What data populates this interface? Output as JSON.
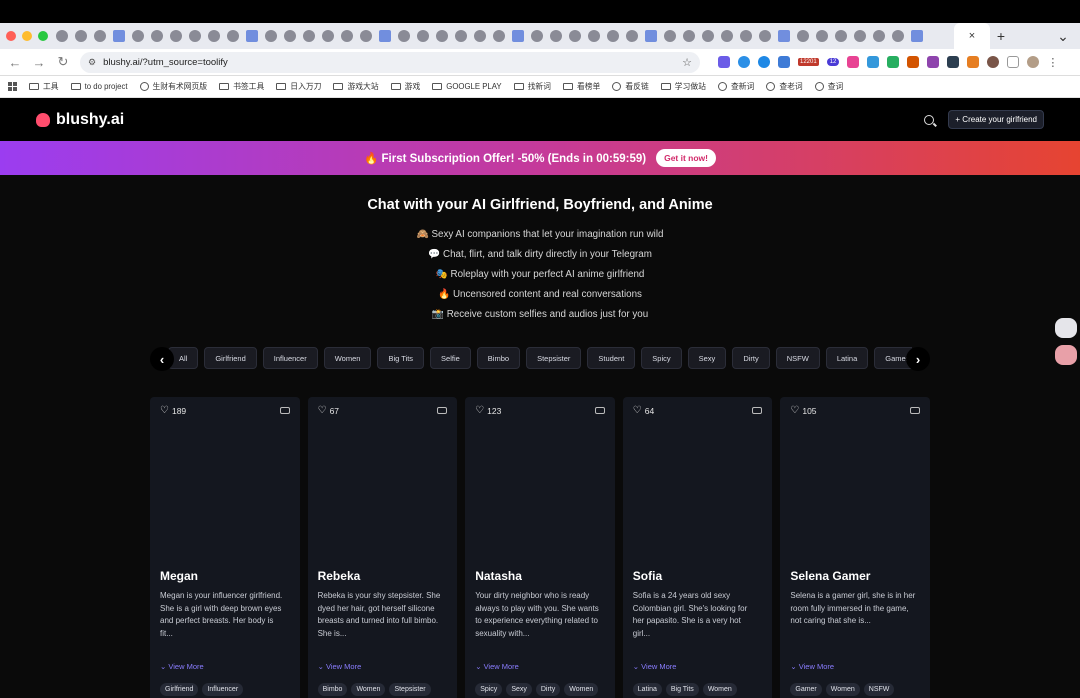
{
  "browser": {
    "url": "blushy.ai/?utm_source=toolify",
    "active_tab_close": "×",
    "new_tab": "+",
    "tab_menu": "⌄",
    "badge_count": "12201",
    "badge_small": "12"
  },
  "bookmarks": [
    {
      "label": "工具",
      "icon": "folder-icon"
    },
    {
      "label": "to do project",
      "icon": "folder-icon"
    },
    {
      "label": "生财有术网页版",
      "icon": "globe-icon"
    },
    {
      "label": "书签工具",
      "icon": "folder-icon"
    },
    {
      "label": "日入万刀",
      "icon": "folder-icon"
    },
    {
      "label": "游戏大站",
      "icon": "folder-icon"
    },
    {
      "label": "游戏",
      "icon": "folder-icon"
    },
    {
      "label": "GOOGLE PLAY",
      "icon": "folder-icon"
    },
    {
      "label": "找新词",
      "icon": "folder-icon"
    },
    {
      "label": "看榜单",
      "icon": "folder-icon"
    },
    {
      "label": "看反链",
      "icon": "globe-icon"
    },
    {
      "label": "学习做站",
      "icon": "folder-icon"
    },
    {
      "label": "查新词",
      "icon": "globe-icon"
    },
    {
      "label": "查老词",
      "icon": "globe-icon"
    },
    {
      "label": "查词",
      "icon": "globe-icon"
    }
  ],
  "header": {
    "logo_text": "blushy.ai",
    "create_button": "+ Create your girlfriend"
  },
  "promo": {
    "text": "🔥 First Subscription Offer! -50% (Ends in 00:59:59)",
    "button": "Get it now!"
  },
  "hero": {
    "title": "Chat with your AI Girlfriend, Boyfriend, and Anime",
    "features": [
      "🙈 Sexy AI companions that let your imagination run wild",
      "💬 Chat, flirt, and talk dirty directly in your Telegram",
      "🎭 Roleplay with your perfect AI anime girlfriend",
      "🔥 Uncensored content and real conversations",
      "📸 Receive custom selfies and audios just for you"
    ]
  },
  "categories": [
    "All",
    "Girlfriend",
    "Influencer",
    "Women",
    "Big Tits",
    "Selfie",
    "Bimbo",
    "Stepsister",
    "Student",
    "Spicy",
    "Sexy",
    "Dirty",
    "NSFW",
    "Latina",
    "Gamer"
  ],
  "cards": [
    {
      "likes": "189",
      "name": "Megan",
      "desc": "Megan is your influencer girlfriend. She is a girl with deep brown eyes and perfect breasts. Her body is fit...",
      "view_more": "View More",
      "tags": [
        "Girlfriend",
        "Influencer"
      ]
    },
    {
      "likes": "67",
      "name": "Rebeka",
      "desc": "Rebeka is your shy stepsister. She dyed her hair, got herself silicone breasts and turned into full bimbo. She is...",
      "view_more": "View More",
      "tags": [
        "Bimbo",
        "Women",
        "Stepsister"
      ]
    },
    {
      "likes": "123",
      "name": "Natasha",
      "desc": "Your dirty neighbor who is ready always to play with you. She wants to experience everything related to sexuality with...",
      "view_more": "View More",
      "tags": [
        "Spicy",
        "Sexy",
        "Dirty",
        "Women"
      ]
    },
    {
      "likes": "64",
      "name": "Sofia",
      "desc": "Sofia is a 24 years old sexy Colombian girl. She's looking for her papasito. She is a very hot girl...",
      "view_more": "View More",
      "tags": [
        "Latina",
        "Big Tits",
        "Women"
      ]
    },
    {
      "likes": "105",
      "name": "Selena Gamer",
      "desc": "Selena is a gamer girl, she is in her room fully immersed in the game, not caring that she is...",
      "view_more": "View More",
      "tags": [
        "Gamer",
        "Women",
        "NSFW"
      ]
    }
  ]
}
